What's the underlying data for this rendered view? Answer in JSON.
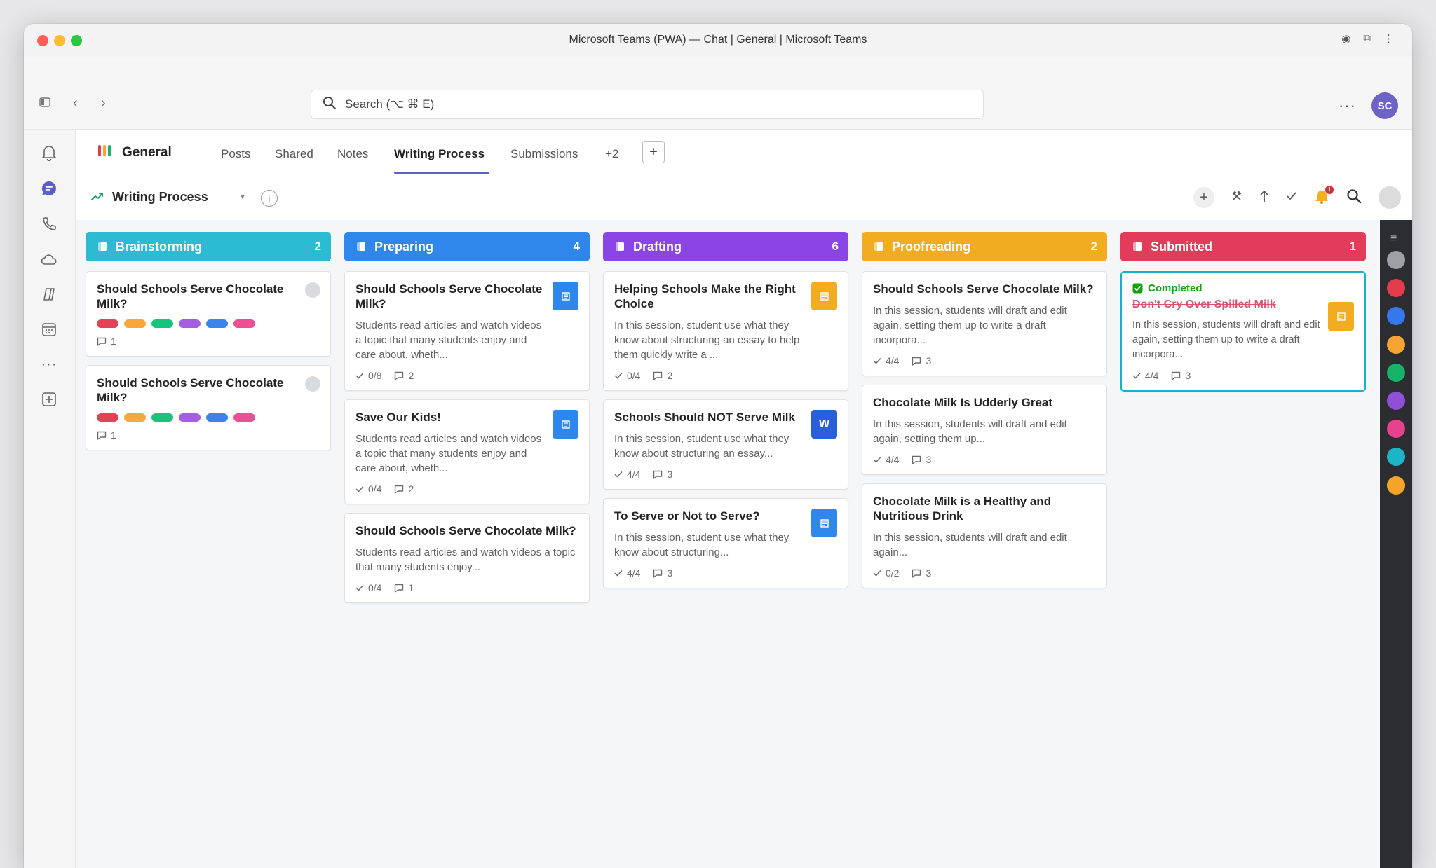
{
  "window": {
    "title": "Microsoft Teams (PWA) — Chat | General | Microsoft Teams"
  },
  "search": {
    "placeholder": "Search (⌥ ⌘ E)"
  },
  "user": {
    "initials": "SC"
  },
  "channel": {
    "name": "General"
  },
  "tabs": [
    {
      "label": "Posts"
    },
    {
      "label": "Shared"
    },
    {
      "label": "Notes"
    },
    {
      "label": "Writing Process",
      "active": true
    },
    {
      "label": "Submissions"
    },
    {
      "label": "+2"
    }
  ],
  "board": {
    "title": "Writing Process",
    "notification_count": "1",
    "columns": [
      {
        "title": "Brainstorming",
        "count": "2",
        "color": "#2bbcd4",
        "cards": [
          {
            "title": "Should Schools Serve Chocolate Milk?",
            "comments": "1"
          },
          {
            "title": "Should Schools Serve Chocolate Milk?",
            "comments": "1"
          }
        ]
      },
      {
        "title": "Preparing",
        "count": "4",
        "color": "#2f86eb",
        "cards": [
          {
            "title": "Should Schools Serve Chocolate Milk?",
            "desc": "Students read articles and watch videos a topic that many students enjoy and care about, wheth...",
            "checks": "0/8",
            "comments": "2"
          },
          {
            "title": "Save Our Kids!",
            "desc": "Students read articles and watch videos a topic that many students enjoy and care about, wheth...",
            "checks": "0/4",
            "comments": "2"
          },
          {
            "title": "Should Schools Serve Chocolate Milk?",
            "desc": "Students read articles and watch videos a topic that many students enjoy...",
            "checks": "0/4",
            "comments": "1"
          }
        ]
      },
      {
        "title": "Drafting",
        "count": "6",
        "color": "#8b45e6",
        "cards": [
          {
            "title": "Helping Schools Make the Right Choice",
            "desc": "In this session, student use what they know about structuring an essay to help them quickly write a ...",
            "checks": "0/4",
            "comments": "2"
          },
          {
            "title": "Schools Should NOT Serve Milk",
            "desc": "In this session, student use what they know about structuring an essay...",
            "checks": "4/4",
            "comments": "3",
            "doc_letter": "W"
          },
          {
            "title": "To Serve or Not to Serve?",
            "desc": "In this session, student use what they know about structuring...",
            "checks": "4/4",
            "comments": "3"
          }
        ]
      },
      {
        "title": "Proofreading",
        "count": "2",
        "color": "#f2ac22",
        "cards": [
          {
            "title": "Should Schools Serve Chocolate Milk?",
            "desc": "In this session, students will draft and edit again, setting them up to write a draft incorpora...",
            "checks": "4/4",
            "comments": "3"
          },
          {
            "title": "Chocolate Milk Is Udderly Great",
            "desc": "In this session, students will draft and edit again, setting them up...",
            "checks": "4/4",
            "comments": "3"
          },
          {
            "title": "Chocolate Milk is a Healthy and Nutritious Drink",
            "desc": "In this session, students will draft and edit again...",
            "checks": "0/2",
            "comments": "3"
          }
        ]
      },
      {
        "title": "Submitted",
        "count": "1",
        "color": "#e23c5a",
        "cards": [
          {
            "status": "Completed",
            "title": "Don't Cry Over Spilled Milk",
            "desc": "In this session, students will draft and edit again, setting them up to write a draft incorpora...",
            "checks": "4/4",
            "comments": "3"
          }
        ]
      }
    ]
  },
  "tag_colors": [
    "#e24456",
    "#f8a83a",
    "#16c47d",
    "#a45ee0",
    "#3a84ec",
    "#ec4f94"
  ],
  "doc_colors": {
    "blue": "#2f86eb",
    "yellow": "#f2ac22",
    "word": "#2b5fd9"
  },
  "palette": [
    "#9ea0a5",
    "#e23c4d",
    "#3577ec",
    "#f7a432",
    "#16b368",
    "#8f4fd6",
    "#e7438c",
    "#1bb5c5",
    "#f4a527"
  ]
}
